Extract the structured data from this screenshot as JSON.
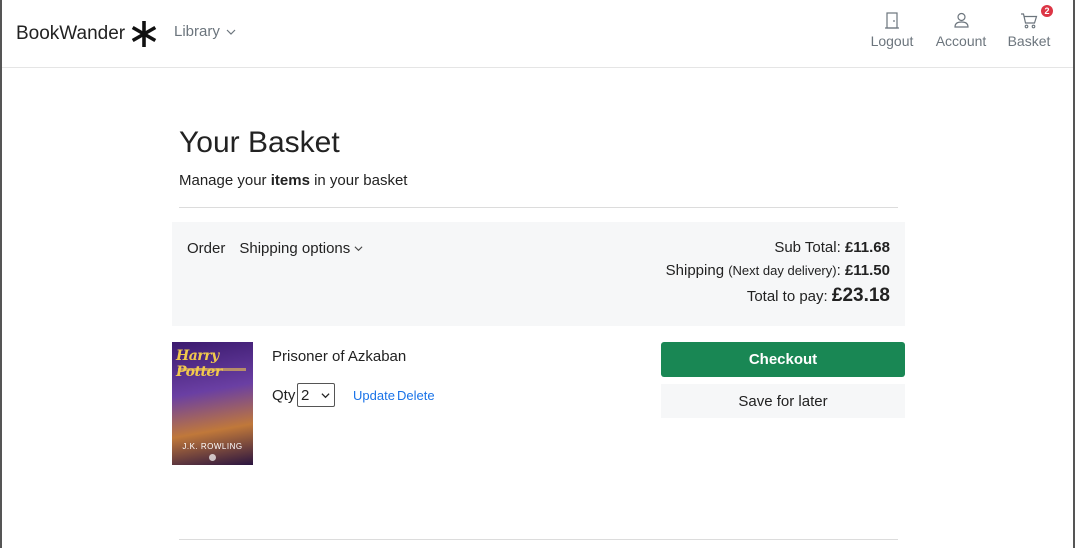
{
  "header": {
    "brand": "BookWander",
    "brand_icon": "asterisk-logo",
    "library": "Library",
    "logout": "Logout",
    "account": "Account",
    "basket": "Basket",
    "basket_count": "2",
    "badge_color": "#dc3545"
  },
  "page": {
    "title": "Your Basket",
    "subtitle_pre": "Manage your ",
    "subtitle_bold": "items",
    "subtitle_post": " in your basket"
  },
  "summary": {
    "tab_order": "Order",
    "tab_shipping": "Shipping options",
    "subtotal_label": "Sub Total: ",
    "subtotal_value": "£11.68",
    "shipping_label": "Shipping ",
    "shipping_note": "(Next day delivery)",
    "shipping_colon": ": ",
    "shipping_value": "£11.50",
    "total_label": "Total to pay: ",
    "total_value": "£23.18"
  },
  "item": {
    "title": "Prisoner of Azkaban",
    "cover_title": "Harry Potter",
    "cover_author": "J.K. ROWLING",
    "qty_label": "Qty",
    "qty_value": "2",
    "update": "Update",
    "delete": "Delete"
  },
  "actions": {
    "checkout": "Checkout",
    "checkout_color": "#198754",
    "save_for_later": "Save for later"
  }
}
